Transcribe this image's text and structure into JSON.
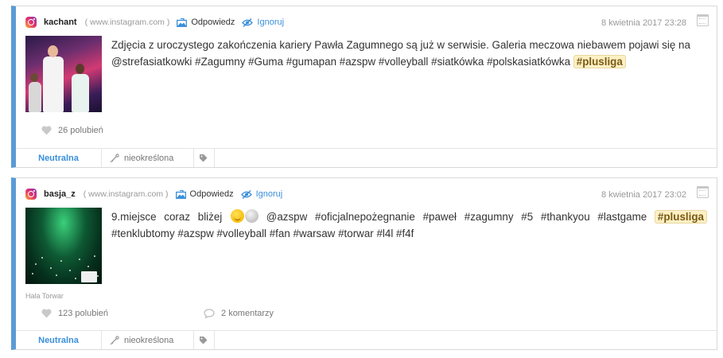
{
  "colors": {
    "accent": "#5b9bd5",
    "link": "#3a8fd9",
    "highlight": "#fcf0c4"
  },
  "posts": [
    {
      "author": "kachant",
      "source": "( www.instagram.com )",
      "reply_label": "Odpowiedz",
      "ignore_label": "Ignoruj",
      "date": "8 kwietnia 2017 23:28",
      "text": "Zdjęcia z uroczystego zakończenia kariery Pawła Zagumnego są już w serwisie. Galeria meczowa niebawem pojawi się na @strefasiatkowki #Zagumny #Guma #gumapan #azspw #volleyball #siatkówka #polskasiatkówka",
      "highlight_tag": "#plusliga",
      "likes": "26 polubień",
      "sentiment": "Neutralna",
      "category": "nieokreślona"
    },
    {
      "author": "basja_z",
      "source": "( www.instagram.com )",
      "reply_label": "Odpowiedz",
      "ignore_label": "Ignoruj",
      "date": "8 kwietnia 2017 23:02",
      "text_before": "9.miejsce coraz bliżej",
      "text_after": "@azspw #oficjalnepożegnanie #paweł #zagumny #5 #thankyou #lastgame",
      "highlight_tag": "#plusliga",
      "text_tail": "#tenklubtomy #azspw #volleyball #fan #warsaw #torwar #l4l #f4f",
      "place": "Hala Torwar",
      "likes": "123 polubień",
      "comments": "2 komentarzy",
      "sentiment": "Neutralna",
      "category": "nieokreślona"
    }
  ]
}
